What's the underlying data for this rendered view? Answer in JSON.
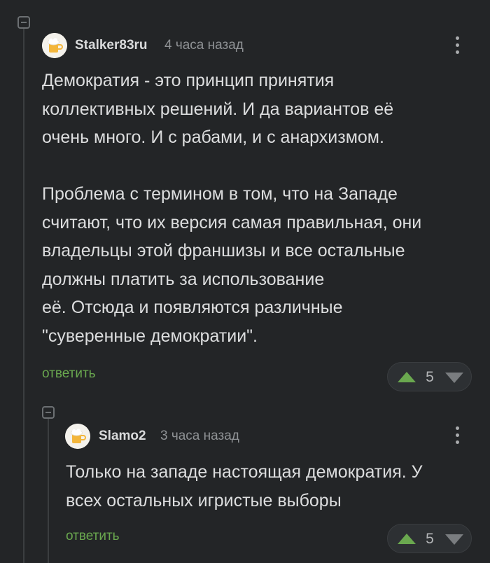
{
  "comments": [
    {
      "username": "Stalker83ru",
      "time": "4 часа назад",
      "text": "Демократия - это принцип принятия\nколлективных решений. И да вариантов её\nочень много. И с рабами, и с анархизмом.\n\nПроблема с термином в том, что на Западе\nсчитают, что их версия самая правильная, они\nвладельцы этой франшизы и все остальные\nдолжны платить за использование\nеё. Отсюда и появляются различные\n\"суверенные демократии\".",
      "reply_label": "ответить",
      "rating": "5"
    },
    {
      "username": "Slamo2",
      "time": "3 часа назад",
      "text": "Только на западе настоящая демократия. У\nвсех остальных игристые выборы",
      "reply_label": "ответить",
      "rating": "5"
    }
  ],
  "colors": {
    "background": "#232527",
    "reply_link": "#6aa84f",
    "upvote": "#6aa84f",
    "downvote": "#7a7d80"
  },
  "icons": {
    "collapse": "minus-square-icon",
    "menu": "three-dots-vertical-icon",
    "upvote": "triangle-up-icon",
    "downvote": "triangle-down-icon",
    "avatar": "beer-mug-avatar"
  }
}
